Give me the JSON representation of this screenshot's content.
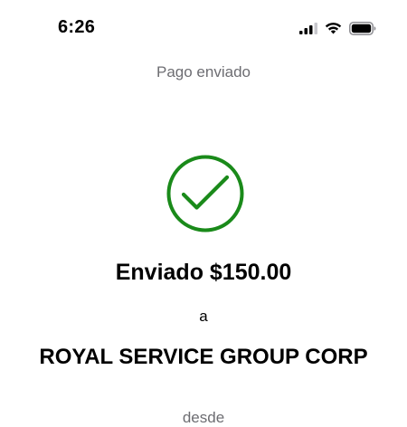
{
  "status_bar": {
    "time": "6:26",
    "icons": [
      "cellular-signal-icon",
      "wifi-icon",
      "battery-icon"
    ]
  },
  "header": {
    "title": "Pago enviado"
  },
  "confirmation": {
    "icon": "checkmark-circle-icon",
    "icon_color": "#1a8a1a",
    "amount_text": "Enviado $150.00",
    "to_label": "a",
    "recipient": "ROYAL SERVICE GROUP CORP",
    "from_label": "desde"
  }
}
